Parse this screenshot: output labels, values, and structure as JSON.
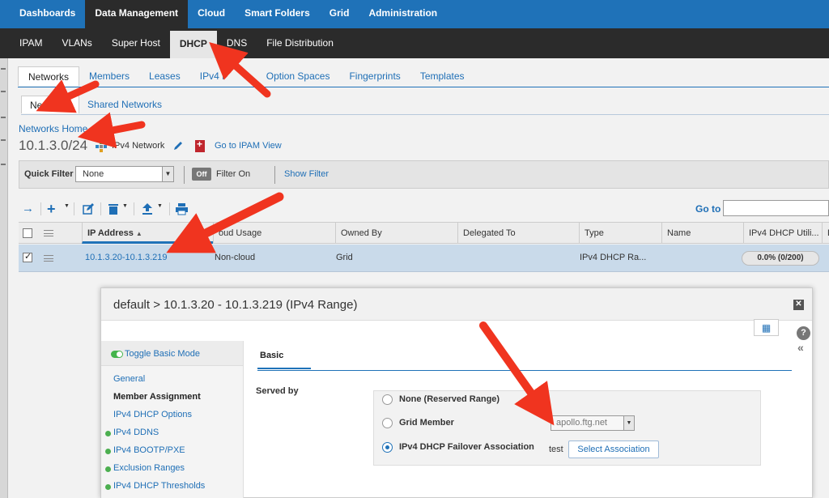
{
  "topnav": {
    "items": [
      "Dashboards",
      "Data Management",
      "Cloud",
      "Smart Folders",
      "Grid",
      "Administration"
    ]
  },
  "subnav": {
    "items": [
      "IPAM",
      "VLANs",
      "Super Host",
      "DHCP",
      "DNS",
      "File Distribution"
    ]
  },
  "tabs": {
    "items": [
      "Networks",
      "Members",
      "Leases",
      "IPv4 F",
      "Option Spaces",
      "Fingerprints",
      "Templates"
    ]
  },
  "subtabs": {
    "items": [
      "Networks",
      "Shared Networks"
    ]
  },
  "breadcrumb": "Networks Home",
  "network": {
    "address": "10.1.3.0/24",
    "type": "IPv4 Network",
    "ipam_link": "Go to IPAM View"
  },
  "filter": {
    "label": "Quick Filter",
    "value": "None",
    "toggle": "Off",
    "toggle_label": "Filter On",
    "show_filter": "Show Filter"
  },
  "goto": {
    "label": "Go to",
    "value": ""
  },
  "grid": {
    "columns": [
      "IP Address",
      "oud Usage",
      "Owned By",
      "Delegated To",
      "Type",
      "Name",
      "IPv4 DHCP Utili...",
      "D"
    ],
    "row": {
      "ip": "10.1.3.20-10.1.3.219",
      "cloud": "Non-cloud",
      "owned": "Grid",
      "delegated": "",
      "type": "IPv4 DHCP Ra...",
      "name": "",
      "util": "0.0% (0/200)"
    }
  },
  "dialog": {
    "title": "default > 10.1.3.20 - 10.1.3.219 (IPv4 Range)",
    "toggle_mode": "Toggle Basic Mode",
    "nav": [
      "General",
      "Member Assignment",
      "IPv4 DHCP Options",
      "IPv4 DDNS",
      "IPv4 BOOTP/PXE",
      "Exclusion Ranges",
      "IPv4 DHCP Thresholds"
    ],
    "tab": "Basic",
    "served_by": "Served by",
    "options": [
      "None (Reserved Range)",
      "Grid Member",
      "IPv4 DHCP Failover Association"
    ],
    "member_value": "apollo.ftg.net",
    "association_value": "test",
    "select_association": "Select Association"
  },
  "colors": {
    "brand": "#1f72b8",
    "dark_nav": "#2b2b2b",
    "annotation": "#f0341f",
    "row_selected": "#c9daea"
  }
}
